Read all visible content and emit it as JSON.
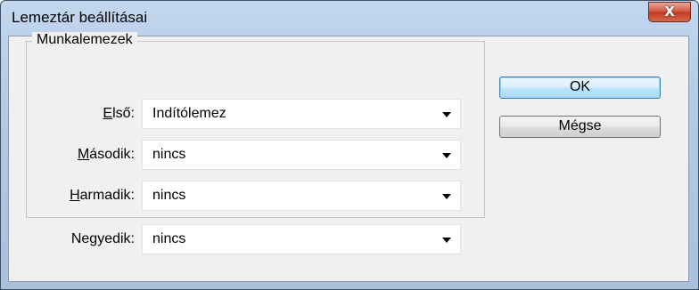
{
  "window": {
    "title": "Lemeztár beállításai",
    "close_glyph": "X"
  },
  "group": {
    "legend": "Munkalemezek"
  },
  "fields": [
    {
      "label_pre": "",
      "label_key": "E",
      "label_post": "lső:",
      "value": "Indítólemez"
    },
    {
      "label_pre": "",
      "label_key": "M",
      "label_post": "ásodik:",
      "value": "nincs"
    },
    {
      "label_pre": "",
      "label_key": "H",
      "label_post": "armadik:",
      "value": "nincs"
    },
    {
      "label_pre": "Ne",
      "label_key": "g",
      "label_post": "yedik:",
      "value": "nincs"
    }
  ],
  "buttons": {
    "ok_label": "OK",
    "cancel_label": "Mégse"
  },
  "colors": {
    "title_gradient": "#b3c9e3",
    "client_bg": "#f0f0f0",
    "close_red": "#c23a20",
    "default_button_border": "#3c7fb1"
  },
  "icons": {
    "close": "close-icon",
    "dropdown": "chevron-down-icon"
  }
}
